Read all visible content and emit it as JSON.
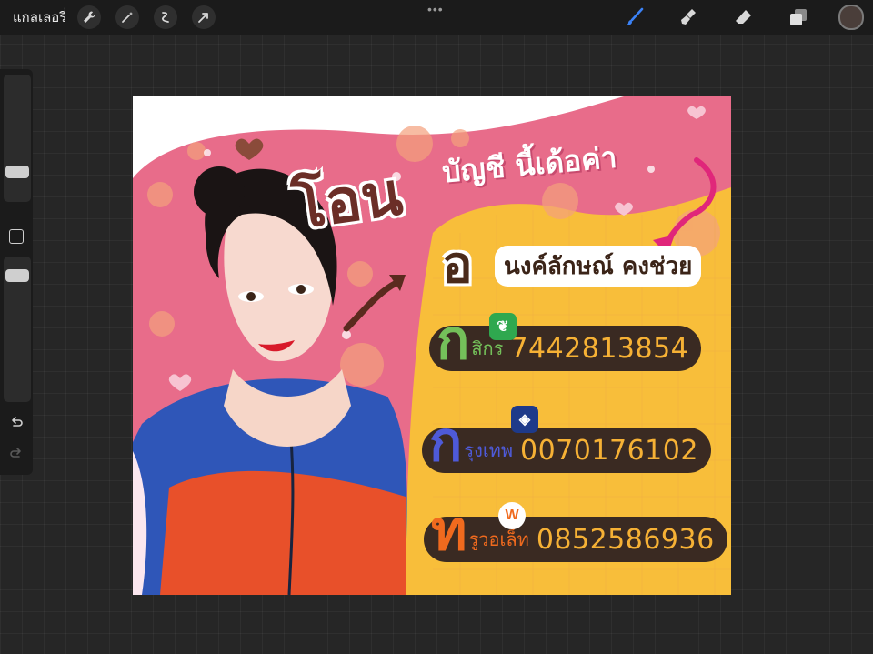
{
  "toolbar": {
    "gallery_label": "แกลเลอรี่",
    "left_tools": [
      "wrench-icon",
      "magic-wand-icon",
      "selection-icon",
      "transform-arrow-icon"
    ],
    "right_tools": [
      "brush-icon",
      "smudge-icon",
      "eraser-icon",
      "layers-icon"
    ],
    "active_tool": "brush",
    "brush_color": "#4a3e3a",
    "more_dots": "•••"
  },
  "sidebar": {
    "brush_size_level": 0.55,
    "opacity_level": 0.7,
    "buttons": [
      "modify-button",
      "undo-button",
      "redo-button"
    ]
  },
  "artwork": {
    "headline_big": "โอน",
    "headline_small": "บัญชี นี้เด้อค่า",
    "subline_big": "อ",
    "subline_small": "นงค์ลักษณ์ คงช่วย",
    "banks": [
      {
        "initial": "ก",
        "name": "สิกร",
        "account": "7442813854",
        "initial_color": "#74c05a",
        "logo_color": "#2fa84f"
      },
      {
        "initial": "ก",
        "name": "รุงเทพ",
        "account": "0070176102",
        "initial_color": "#4e5ad8",
        "logo_color": "#1e3a8a"
      },
      {
        "initial": "ท",
        "name": "รูวอเล็ท",
        "account": "0852586936",
        "initial_color": "#f06a1e",
        "logo_color": "#ffffff"
      }
    ],
    "colors": {
      "pink_bg": "#e86c8a",
      "yellow_panel": "#f8be3a",
      "plate_dark": "#3a2a22",
      "account_text": "#f6b135"
    }
  }
}
